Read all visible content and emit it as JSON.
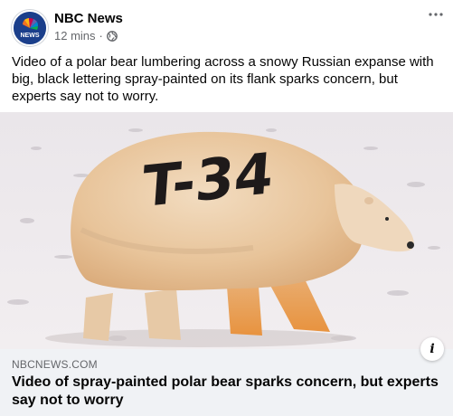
{
  "post": {
    "page_name": "NBC News",
    "time": "12 mins",
    "caption": "Video of a polar bear lumbering across a snowy Russian expanse with big, black lettering spray-painted on its flank sparks concern, but experts say not to worry.",
    "avatar_label": "NEWS"
  },
  "media": {
    "painted_text": "T-34",
    "info_label": "i"
  },
  "link_preview": {
    "domain": "NBCNEWS.COM",
    "headline": "Video of spray-painted polar bear sparks concern, but experts say not to worry"
  },
  "colors": {
    "brand_blue": "#1b3f8b",
    "secondary_text": "#65676b",
    "preview_bg": "#f0f2f5"
  },
  "icons": [
    "nbc-peacock-icon",
    "globe-icon",
    "more-options-icon",
    "info-icon"
  ]
}
